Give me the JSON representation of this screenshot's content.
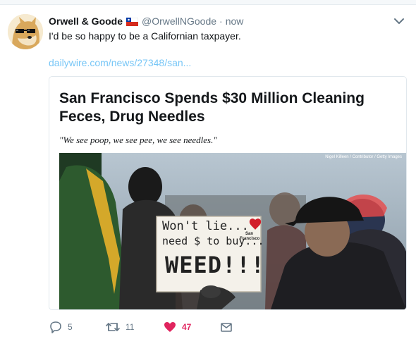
{
  "tweet": {
    "display_name": "Orwell & Goode",
    "handle": "@OrwellNGoode",
    "separator": "·",
    "time": "now",
    "text": "I'd be so happy to be a Californian taxpayer.",
    "link_text": "dailywire.com/news/27348/san..."
  },
  "card": {
    "title": "San Francisco Spends $30 Million Cleaning Feces, Drug Needles",
    "subtitle": "\"We see poop, we see pee, we see needles.\"",
    "image_credit": "Nigel Killeen / Contributor / Getty Images",
    "sign": {
      "line1": "Won't lie...",
      "line2": "need $ to buy...",
      "line3": "WEED!!!",
      "corner_label_1": "San",
      "corner_label_2": "Francisco"
    }
  },
  "actions": {
    "reply_count": "5",
    "retweet_count": "11",
    "like_count": "47"
  },
  "colors": {
    "like": "#e0245e",
    "link": "#4ab3f4",
    "muted": "#657786"
  },
  "icons": [
    "doge-avatar",
    "chile-flag-icon",
    "chevron-down-icon",
    "reply-icon",
    "retweet-icon",
    "heart-icon",
    "envelope-icon"
  ]
}
